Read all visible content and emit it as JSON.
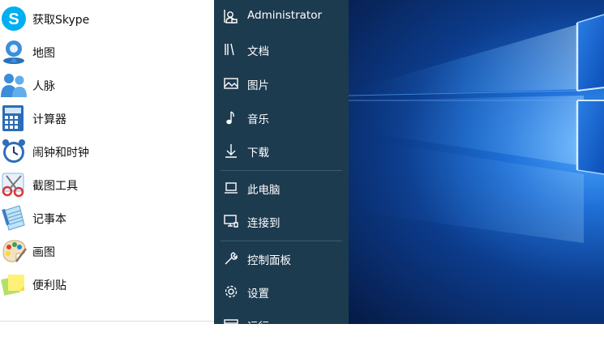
{
  "apps": [
    {
      "label": "获取Skype",
      "icon": "skype-icon"
    },
    {
      "label": "地图",
      "icon": "maps-icon"
    },
    {
      "label": "人脉",
      "icon": "people-icon"
    },
    {
      "label": "计算器",
      "icon": "calculator-icon"
    },
    {
      "label": "闹钟和时钟",
      "icon": "alarm-clock-icon"
    },
    {
      "label": "截图工具",
      "icon": "snipping-tool-icon"
    },
    {
      "label": "记事本",
      "icon": "notepad-icon"
    },
    {
      "label": "画图",
      "icon": "paint-icon"
    },
    {
      "label": "便利贴",
      "icon": "sticky-notes-icon"
    }
  ],
  "nav": {
    "user": {
      "label": "Administrator",
      "icon": "user-account-icon"
    },
    "items": [
      {
        "label": "文档",
        "icon": "documents-icon"
      },
      {
        "label": "图片",
        "icon": "pictures-icon"
      },
      {
        "label": "音乐",
        "icon": "music-icon"
      },
      {
        "label": "下载",
        "icon": "download-icon"
      },
      {
        "label": "此电脑",
        "icon": "this-pc-icon"
      },
      {
        "label": "连接到",
        "icon": "connect-icon"
      },
      {
        "label": "控制面板",
        "icon": "control-panel-icon"
      },
      {
        "label": "设置",
        "icon": "settings-icon"
      },
      {
        "label": "运行",
        "icon": "run-icon"
      }
    ]
  },
  "colors": {
    "nav_background": "#1d3b4f",
    "wallpaper_accent": "#2f8ff0"
  }
}
